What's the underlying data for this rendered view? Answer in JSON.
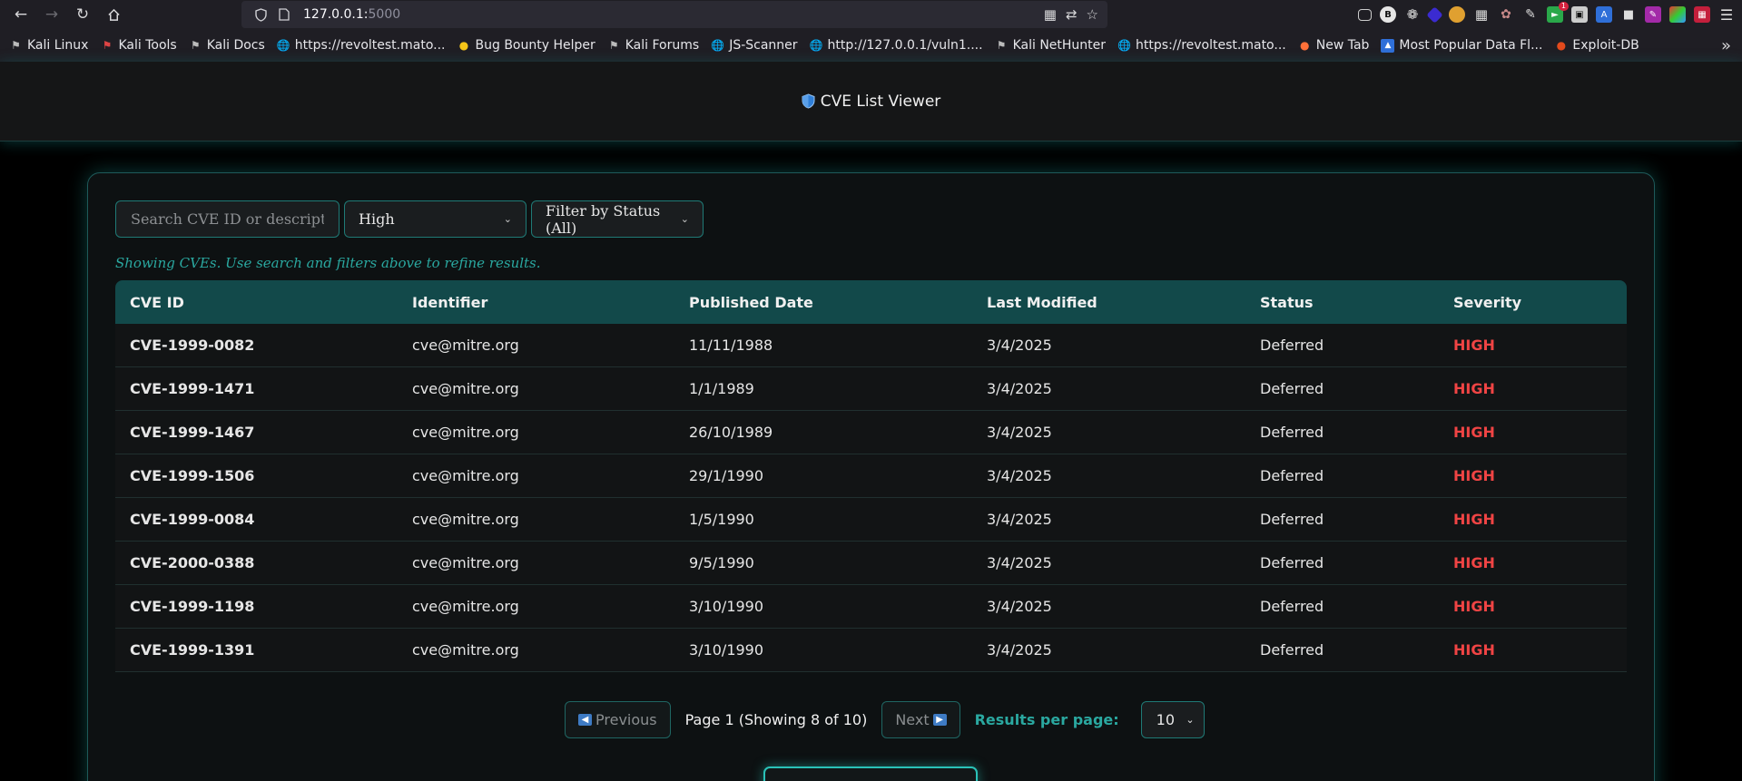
{
  "browser": {
    "url_host": "127.0.0.1:",
    "url_port": "5000",
    "bookmarks": [
      {
        "label": "Kali Linux",
        "icon": "kali-dragon-icon"
      },
      {
        "label": "Kali Tools",
        "icon": "kali-tools-icon"
      },
      {
        "label": "Kali Docs",
        "icon": "kali-dragon-icon"
      },
      {
        "label": "https://revoltest.mato...",
        "icon": "globe-icon"
      },
      {
        "label": "Bug Bounty Helper",
        "icon": "emoji-face-icon"
      },
      {
        "label": "Kali Forums",
        "icon": "kali-dragon-icon"
      },
      {
        "label": "JS-Scanner",
        "icon": "globe-icon"
      },
      {
        "label": "http://127.0.0.1/vuln1....",
        "icon": "globe-icon"
      },
      {
        "label": "Kali NetHunter",
        "icon": "kali-dragon-icon"
      },
      {
        "label": "https://revoltest.mato...",
        "icon": "globe-icon"
      },
      {
        "label": "New Tab",
        "icon": "firefox-icon"
      },
      {
        "label": "Most Popular Data Fl...",
        "icon": "data-icon"
      },
      {
        "label": "Exploit-DB",
        "icon": "exploit-db-icon"
      }
    ],
    "extension_badge": "1"
  },
  "app": {
    "title": "CVE List Viewer",
    "search_placeholder": "Search CVE ID or description...",
    "severity_filter": "High",
    "status_filter": "Filter by Status (All)",
    "hint": "Showing CVEs. Use search and filters above to refine results."
  },
  "table": {
    "headers": [
      "CVE ID",
      "Identifier",
      "Published Date",
      "Last Modified",
      "Status",
      "Severity"
    ],
    "rows": [
      [
        "CVE-1999-0082",
        "cve@mitre.org",
        "11/11/1988",
        "3/4/2025",
        "Deferred",
        "HIGH"
      ],
      [
        "CVE-1999-1471",
        "cve@mitre.org",
        "1/1/1989",
        "3/4/2025",
        "Deferred",
        "HIGH"
      ],
      [
        "CVE-1999-1467",
        "cve@mitre.org",
        "26/10/1989",
        "3/4/2025",
        "Deferred",
        "HIGH"
      ],
      [
        "CVE-1999-1506",
        "cve@mitre.org",
        "29/1/1990",
        "3/4/2025",
        "Deferred",
        "HIGH"
      ],
      [
        "CVE-1999-0084",
        "cve@mitre.org",
        "1/5/1990",
        "3/4/2025",
        "Deferred",
        "HIGH"
      ],
      [
        "CVE-2000-0388",
        "cve@mitre.org",
        "9/5/1990",
        "3/4/2025",
        "Deferred",
        "HIGH"
      ],
      [
        "CVE-1999-1198",
        "cve@mitre.org",
        "3/10/1990",
        "3/4/2025",
        "Deferred",
        "HIGH"
      ],
      [
        "CVE-1999-1391",
        "cve@mitre.org",
        "3/10/1990",
        "3/4/2025",
        "Deferred",
        "HIGH"
      ]
    ]
  },
  "pager": {
    "previous": "Previous",
    "page_info": "Page 1 (Showing 8 of 10)",
    "next": "Next",
    "rpp_label": "Results per page:",
    "rpp_value": "10"
  },
  "colors": {
    "accent": "#2aa8a0",
    "severity_high": "#f04444",
    "table_header": "#12494a"
  }
}
